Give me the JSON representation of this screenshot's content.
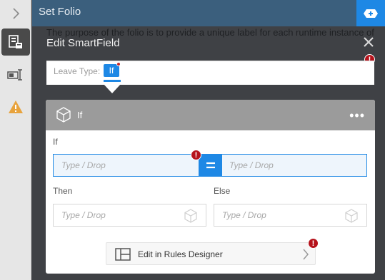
{
  "topbar": {
    "title": "Set Folio"
  },
  "background_text": "The purpose of the folio is to provide a unique label for each runtime instance of",
  "dialog": {
    "title": "Edit SmartField"
  },
  "leave_type": {
    "label": "Leave Type:",
    "chip": "If"
  },
  "if_card": {
    "title": "If",
    "menu": "•••",
    "if_label": "If",
    "left_placeholder": "Type / Drop",
    "right_placeholder": "Type / Drop",
    "then_label": "Then",
    "else_label": "Else",
    "then_placeholder": "Type / Drop",
    "else_placeholder": "Type / Drop",
    "rules_button": "Edit in Rules Designer"
  },
  "colors": {
    "accent": "#1e88e5",
    "error": "#b5121b",
    "warning": "#e8a33d",
    "card_header": "#9b9b9b"
  },
  "icons": [
    "chevron-right-icon",
    "smartfield-icon",
    "form-control-icon",
    "warning-icon",
    "add-icon",
    "close-icon",
    "cube-icon",
    "equals-icon",
    "rules-designer-icon",
    "error-icon"
  ]
}
